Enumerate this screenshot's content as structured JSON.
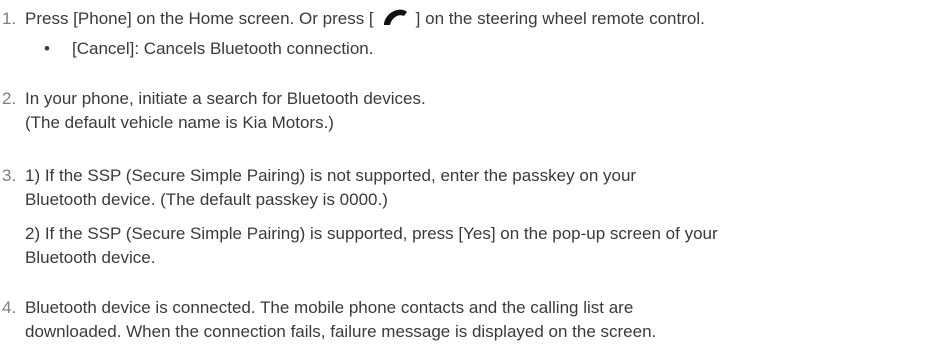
{
  "steps": [
    {
      "number": "1.",
      "text_before_icon": "Press [Phone] on the Home screen. Or press [",
      "icon": "phone-handset-icon",
      "text_after_icon": "] on the steering wheel remote control.",
      "bullet": {
        "marker": "•",
        "text": "[Cancel]: Cancels Bluetooth connection."
      }
    },
    {
      "number": "2.",
      "line1": "In your phone, initiate a search for Bluetooth devices.",
      "line2": "(The default vehicle name is Kia Motors.)"
    },
    {
      "number": "3.",
      "para1_line1": "1) If the SSP (Secure Simple Pairing) is not supported, enter the passkey on your",
      "para1_line2": "Bluetooth device. (The default passkey is 0000.)",
      "para2_line1": "2) If the SSP (Secure Simple Pairing) is supported, press [Yes] on the pop-up screen of  your",
      "para2_line2": "Bluetooth device."
    },
    {
      "number": "4.",
      "line1": "Bluetooth device is connected. The mobile phone contacts and the calling list are",
      "line2": "downloaded. When the connection fails, failure message is displayed on the screen."
    }
  ]
}
